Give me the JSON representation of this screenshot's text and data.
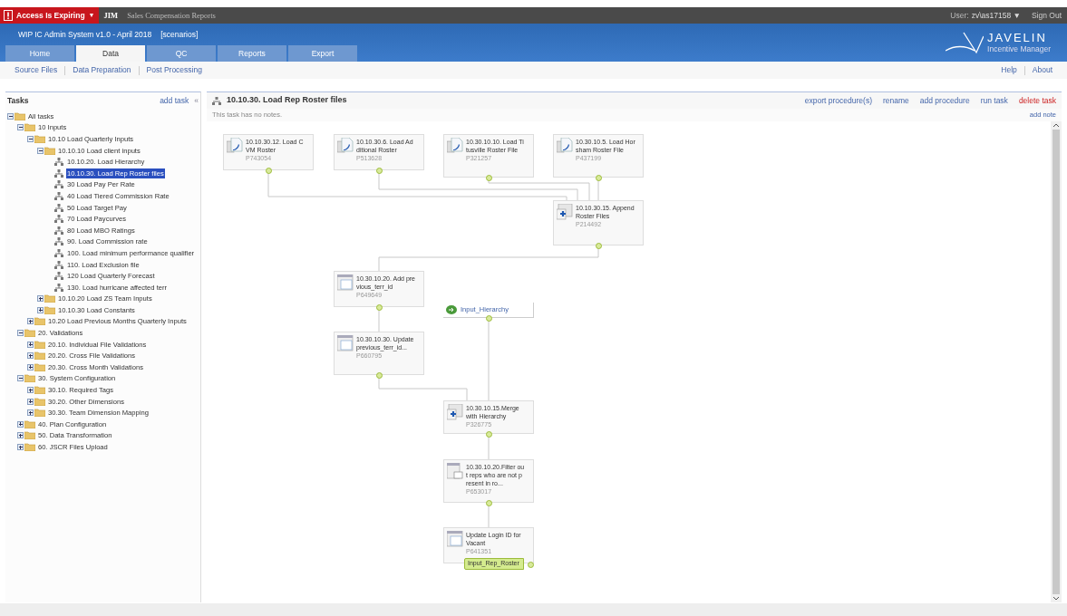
{
  "top_bar": {
    "alert": "Access Is Expiring",
    "alert_caret": "▼",
    "org": "JIM",
    "app_name": "Sales Compensation Reports",
    "user_label": "User:",
    "user": "zv\\as17158",
    "user_caret": "▼",
    "sign_out": "Sign Out"
  },
  "header": {
    "title": "WIP IC Admin System v1.0 - April 2018",
    "scenario": "[scenarios]",
    "logo_name": "JAVELIN",
    "logo_sub": "Incentive Manager"
  },
  "tabs": [
    {
      "label": "Home",
      "selected": false
    },
    {
      "label": "Data",
      "selected": true
    },
    {
      "label": "QC",
      "selected": false
    },
    {
      "label": "Reports",
      "selected": false
    },
    {
      "label": "Export",
      "selected": false
    }
  ],
  "subnav": [
    "Source Files",
    "Data Preparation",
    "Post Processing"
  ],
  "help_links": [
    "Help",
    "About"
  ],
  "tasks_panel": {
    "title": "Tasks",
    "add_task": "add task",
    "collapse": "«",
    "tree": [
      {
        "label": "All tasks",
        "kind": "folder",
        "expanded": true,
        "selected": false,
        "children": [
          {
            "label": "10 Inputs",
            "kind": "folder",
            "expanded": true,
            "selected": false,
            "children": [
              {
                "label": "10.10 Load Quarterly Inputs",
                "kind": "folder",
                "expanded": true,
                "selected": false,
                "children": [
                  {
                    "label": "10.10.10 Load client inputs",
                    "kind": "folder",
                    "expanded": true,
                    "selected": false,
                    "children": [
                      {
                        "label": "10.10.20. Load Hierarchy",
                        "kind": "task",
                        "selected": false
                      },
                      {
                        "label": "10.10.30. Load Rep Roster files",
                        "kind": "task",
                        "selected": true
                      },
                      {
                        "label": "30 Load Pay Per Rate",
                        "kind": "task",
                        "selected": false
                      },
                      {
                        "label": "40 Load Tiered Commission Rate",
                        "kind": "task",
                        "selected": false
                      },
                      {
                        "label": "50 Load Target Pay",
                        "kind": "task",
                        "selected": false
                      },
                      {
                        "label": "70 Load Paycurves",
                        "kind": "task",
                        "selected": false
                      },
                      {
                        "label": "80 Load MBO Ratings",
                        "kind": "task",
                        "selected": false
                      },
                      {
                        "label": "90. Load Commission rate",
                        "kind": "task",
                        "selected": false
                      },
                      {
                        "label": "100. Load minimum performance qualifier",
                        "kind": "task",
                        "selected": false
                      },
                      {
                        "label": "110. Load Exclusion file",
                        "kind": "task",
                        "selected": false
                      },
                      {
                        "label": "120 Load Quarterly Forecast",
                        "kind": "task",
                        "selected": false
                      },
                      {
                        "label": "130. Load hurricane affected terr",
                        "kind": "task",
                        "selected": false
                      }
                    ]
                  },
                  {
                    "label": "10.10.20 Load ZS Team Inputs",
                    "kind": "folder",
                    "expanded": false,
                    "selected": false
                  },
                  {
                    "label": "10.10.30 Load Constants",
                    "kind": "folder",
                    "expanded": false,
                    "selected": false
                  }
                ]
              },
              {
                "label": "10.20 Load Previous Months Quarterly Inputs",
                "kind": "folder",
                "expanded": false,
                "selected": false
              }
            ]
          },
          {
            "label": "20. Validations",
            "kind": "folder",
            "expanded": true,
            "selected": false,
            "children": [
              {
                "label": "20.10. Individual File Validations",
                "kind": "folder",
                "expanded": false,
                "selected": false
              },
              {
                "label": "20.20. Cross File Validations",
                "kind": "folder",
                "expanded": false,
                "selected": false
              },
              {
                "label": "20.30. Cross Month Validations",
                "kind": "folder",
                "expanded": false,
                "selected": false
              }
            ]
          },
          {
            "label": "30. System Configuration",
            "kind": "folder",
            "expanded": true,
            "selected": false,
            "children": [
              {
                "label": "30.10. Required Tags",
                "kind": "folder",
                "expanded": false,
                "selected": false
              },
              {
                "label": "30.20. Other Dimensions",
                "kind": "folder",
                "expanded": false,
                "selected": false
              },
              {
                "label": "30.30. Team Dimension Mapping",
                "kind": "folder",
                "expanded": false,
                "selected": false
              }
            ]
          },
          {
            "label": "40. Plan Configuration",
            "kind": "folder",
            "expanded": false,
            "selected": false
          },
          {
            "label": "50. Data Transformation",
            "kind": "folder",
            "expanded": false,
            "selected": false
          },
          {
            "label": "60. JSCR Files Upload",
            "kind": "folder",
            "expanded": false,
            "selected": false
          }
        ]
      }
    ]
  },
  "task_view": {
    "title": "10.10.30. Load Rep Roster files",
    "actions": [
      {
        "label": "export procedure(s)",
        "kind": "normal"
      },
      {
        "label": "rename",
        "kind": "normal"
      },
      {
        "label": "add procedure",
        "kind": "normal"
      },
      {
        "label": "run task",
        "kind": "normal"
      },
      {
        "label": "delete task",
        "kind": "danger"
      }
    ],
    "notes": "This task has no notes.",
    "add_note": "add note",
    "nodes": [
      {
        "kind": "load",
        "lines": [
          "10.10.30.12. Load C",
          "VM Roster"
        ],
        "id": "P743054"
      },
      {
        "kind": "load",
        "lines": [
          "10.10.30.6. Load Ad",
          "ditional Roster"
        ],
        "id": "P513628"
      },
      {
        "kind": "load",
        "lines": [
          "10.30.10.10. Load Ti",
          "tusville Roster File"
        ],
        "id": "P321257"
      },
      {
        "kind": "load",
        "lines": [
          "10.30.10.5. Load Hor",
          "sham Roster File"
        ],
        "id": "P437199"
      },
      {
        "kind": "merge",
        "lines": [
          "10.10.30.15. Append",
          "Roster Files"
        ],
        "id": "P214492"
      },
      {
        "kind": "table",
        "lines": [
          "10.30.10.20. Add pre",
          "vious_terr_id"
        ],
        "id": "P649649"
      },
      {
        "kind": "table",
        "lines": [
          "10.30.10.30. Update",
          "previous_terr_id..."
        ],
        "id": "P660795"
      },
      {
        "kind": "input",
        "lines": [
          "Input_Hierarchy"
        ]
      },
      {
        "kind": "merge",
        "lines": [
          "10.30.10.15.Merge",
          "with Hierarchy"
        ],
        "id": "P326775"
      },
      {
        "kind": "filter",
        "lines": [
          "10.30.10.20.Filter ou",
          "t reps who are not p",
          "resent in ro..."
        ],
        "id": "P653017"
      },
      {
        "kind": "table",
        "lines": [
          "Update Login ID for",
          "Vacant"
        ],
        "id": "P641351",
        "output": "Input_Rep_Roster"
      }
    ]
  }
}
